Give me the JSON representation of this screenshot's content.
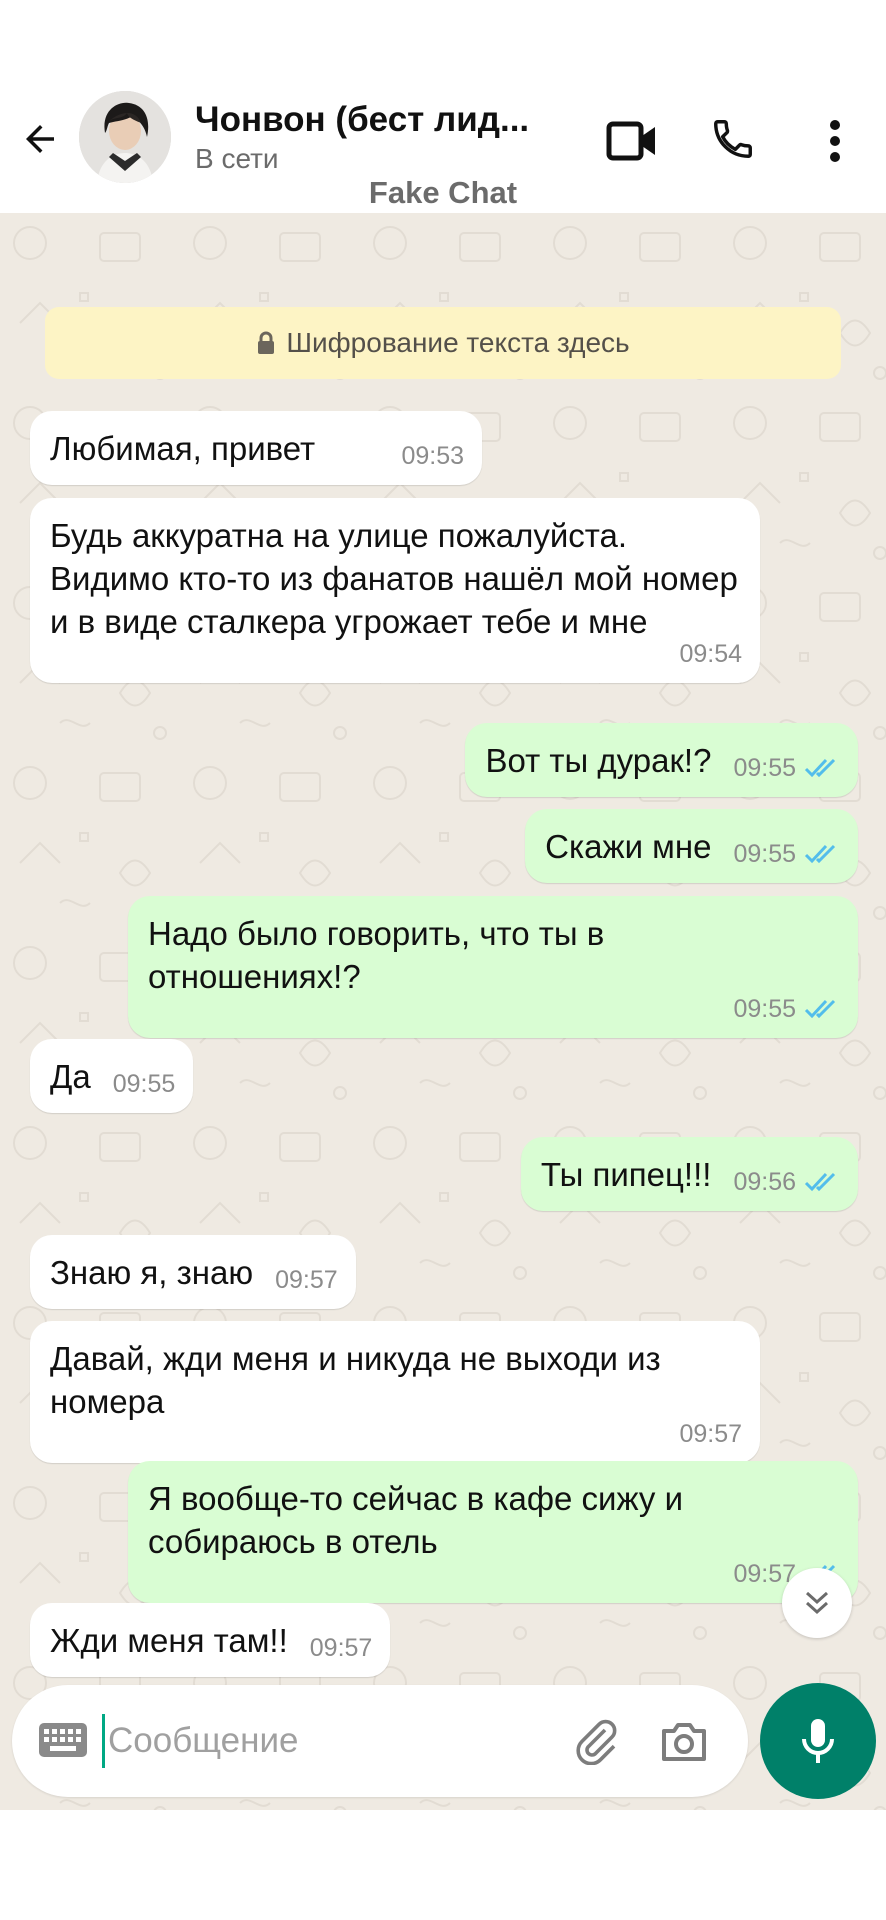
{
  "header": {
    "contact_name": "Чонвон (бест лид...",
    "status": "В сети",
    "watermark": "Fake Chat",
    "icons": [
      "back-arrow-icon",
      "video-call-icon",
      "phone-icon",
      "more-vert-icon"
    ]
  },
  "chat": {
    "encryption_notice": "Шифрование текста здесь",
    "messages": [
      {
        "dir": "in",
        "text": "Любимая, привет",
        "time": "09:53"
      },
      {
        "dir": "in",
        "text": "Будь аккуратна на улице пожалуйста. Видимо кто-то из фанатов нашёл мой номер и в виде сталкера угрожает тебе и мне",
        "time": "09:54"
      },
      {
        "dir": "out",
        "text": "Вот ты дурак!?",
        "time": "09:55",
        "read": true
      },
      {
        "dir": "out",
        "text": "Скажи мне",
        "time": "09:55",
        "read": true
      },
      {
        "dir": "out",
        "text": "Надо было говорить, что ты в отношениях!?",
        "time": "09:55",
        "read": true
      },
      {
        "dir": "in",
        "text": "Да",
        "time": "09:55"
      },
      {
        "dir": "out",
        "text": "Ты пипец!!!",
        "time": "09:56",
        "read": true
      },
      {
        "dir": "in",
        "text": "Знаю я, знаю",
        "time": "09:57"
      },
      {
        "dir": "in",
        "text": "Давай, жди меня и никуда не выходи из номера",
        "time": "09:57"
      },
      {
        "dir": "out",
        "text": "Я вообще-то сейчас в кафе сижу и собираюсь в отель",
        "time": "09:57",
        "read": true
      },
      {
        "dir": "in",
        "text": "Жди меня там!!",
        "time": "09:57"
      }
    ]
  },
  "composer": {
    "placeholder": "Сообщение"
  },
  "colors": {
    "outgoing_bubble": "#d9fdd3",
    "incoming_bubble": "#ffffff",
    "chat_background": "#efeae2",
    "encryption_banner": "#fdf4c5",
    "read_ticks": "#53bdeb",
    "accent": "#008069"
  }
}
